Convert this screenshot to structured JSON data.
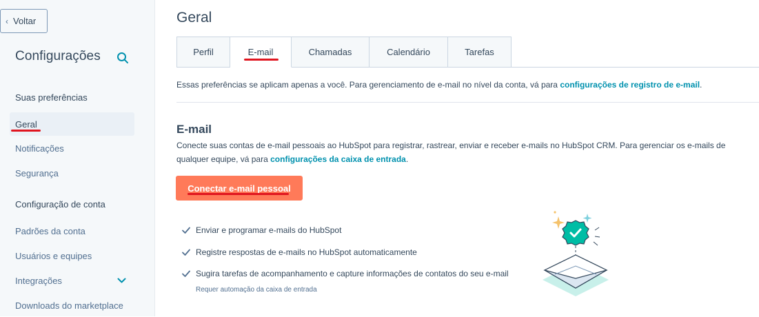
{
  "sidebar": {
    "back_label": "Voltar",
    "title": "Configurações",
    "search_icon": "search-icon",
    "section_preferences": "Suas preferências",
    "items_preferences": [
      {
        "label": "Geral",
        "active": true
      },
      {
        "label": "Notificações",
        "active": false
      },
      {
        "label": "Segurança",
        "active": false
      }
    ],
    "section_account": "Configuração de conta",
    "items_account": [
      {
        "label": "Padrões da conta"
      },
      {
        "label": "Usuários e equipes"
      },
      {
        "label": "Integrações"
      },
      {
        "label": "Downloads do marketplace"
      }
    ]
  },
  "main": {
    "title": "Geral",
    "tabs": [
      {
        "label": "Perfil",
        "active": false
      },
      {
        "label": "E-mail",
        "active": true
      },
      {
        "label": "Chamadas",
        "active": false
      },
      {
        "label": "Calendário",
        "active": false
      },
      {
        "label": "Tarefas",
        "active": false
      }
    ],
    "description_text": "Essas preferências se aplicam apenas a você. Para gerenciamento de e-mail no nível da conta, vá para ",
    "description_link": "configurações de registro de e-mail",
    "description_end": ".",
    "email_section": {
      "title": "E-mail",
      "text": "Conecte suas contas de e-mail pessoais ao HubSpot para registrar, rastrear, enviar e receber e-mails no HubSpot CRM. Para gerenciar os e-mails de qualquer equipe, vá para ",
      "link": "configurações da caixa de entrada",
      "text_end": ".",
      "button_label": "Conectar e-mail pessoal",
      "features": [
        "Enviar e programar e-mails do HubSpot",
        "Registre respostas de e-mails no HubSpot automaticamente",
        "Sugira tarefas de acompanhamento e capture informações de contatos do seu e-mail"
      ],
      "feature_note": "Requer automação da caixa de entrada"
    }
  },
  "colors": {
    "accent": "#0091ae",
    "primary_button": "#ff7a59",
    "annotation": "#e0151f",
    "text": "#33475b"
  }
}
